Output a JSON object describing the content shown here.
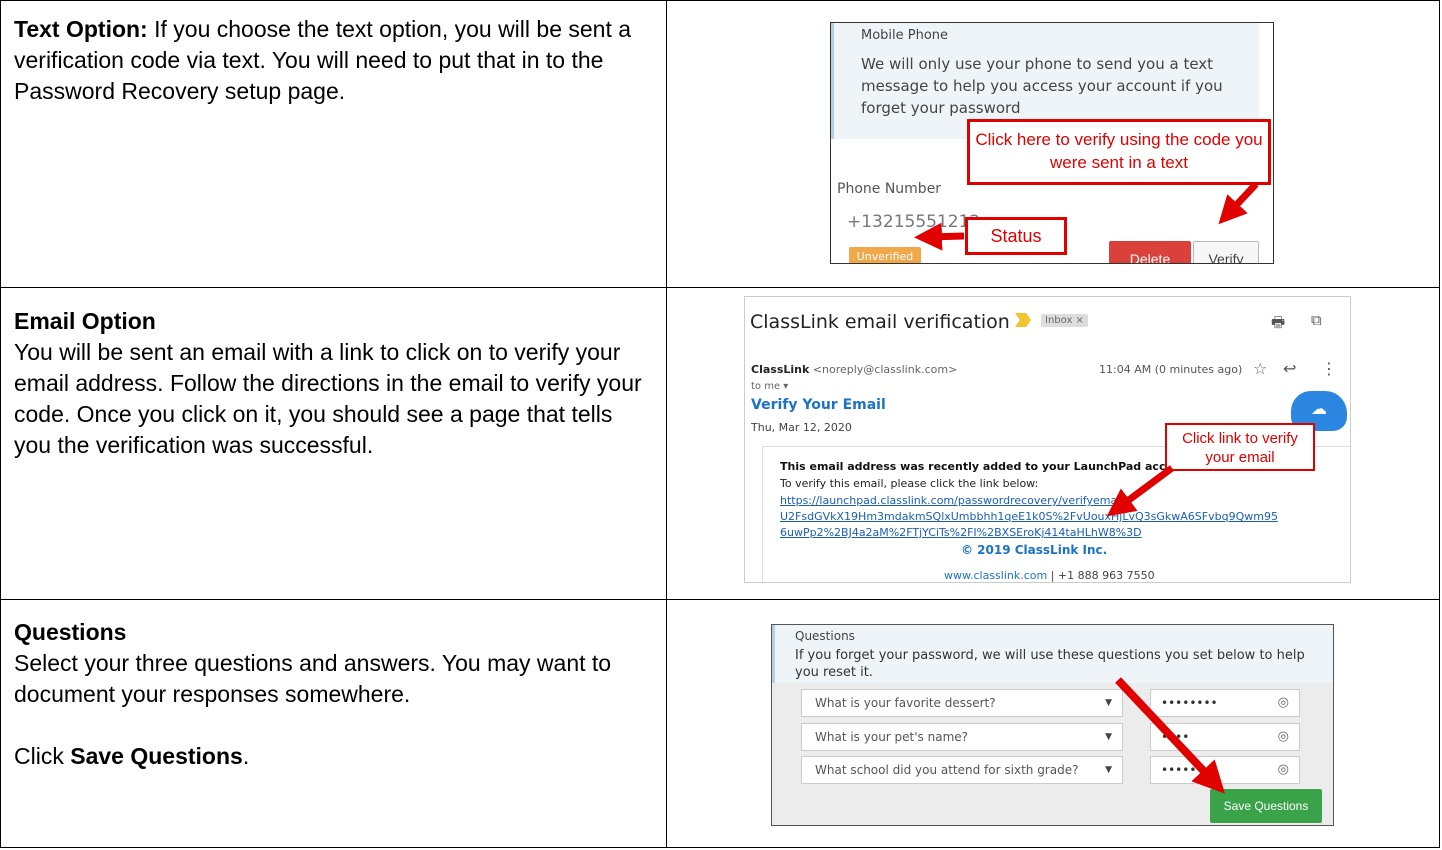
{
  "row1": {
    "heading": "Text Option:",
    "body": " If you choose the text option, you will be sent a verification code via text. You will need to put that in to the Password Recovery setup page.",
    "screenshot": {
      "title": "Mobile Phone",
      "description": "We will only use your phone to send you a text message to help you access your account if you forget your password",
      "phone_label": "Phone Number",
      "phone_value": "+13215551212",
      "status_badge": "Unverified",
      "delete_label": "Delete",
      "verify_label": "Verify",
      "callout_verify": "Click here to verify using the code you were sent in a text",
      "callout_status": "Status"
    }
  },
  "row2": {
    "heading": "Email Option",
    "body": "You will be sent an email with a link to click on to verify your email address.  Follow the directions in the email to verify your code.  Once you click on it, you should see a page that tells you the verification was successful.",
    "screenshot": {
      "subject": "ClassLink email verification",
      "inbox_tag": "Inbox ×",
      "sender_name": "ClassLink",
      "sender_email": "<noreply@classlink.com>",
      "time": "11:04 AM (0 minutes ago)",
      "to_me": "to me ▾",
      "email_title": "Verify Your Email",
      "date": "Thu, Mar 12, 2020",
      "body_bold": "This email address was recently added to your LaunchPad account.",
      "body_line": "To verify this email, please click the link below:",
      "link_line1": "https://launchpad.classlink.com/passwordrecovery/verifyemail?",
      "link_line2": "U2FsdGVkX19Hm3mdakmSQlxUmbbhh1qeE1k0S%2FvUouxHjLvQ3sGkwA6SFvbq9Qwm95",
      "link_line3": "6uwPp2%2BJ4a2aM%2FTjYCiTs%2FI%2BXSEroKj414taHLhW8%3D",
      "copyright": "© 2019 ClassLink Inc.",
      "footer_site": "www.classlink.com",
      "footer_phone": " | +1 888 963 7550",
      "callout": "Click link to verify your email"
    }
  },
  "row3": {
    "heading": "Questions",
    "body": "Select your three questions and answers.  You may want to document your responses somewhere.",
    "click_prefix": "Click ",
    "click_bold": "Save Questions",
    "click_suffix": ".",
    "screenshot": {
      "title": "Questions",
      "description": "If you forget your password, we will use these questions you set below to help you reset it.",
      "questions": [
        {
          "question": "What is your favorite dessert?",
          "answer": "••••••••"
        },
        {
          "question": "What is your pet's name?",
          "answer": "••••"
        },
        {
          "question": "What school did you attend for sixth grade?",
          "answer": "••••••••"
        }
      ],
      "save_label": "Save Questions"
    }
  }
}
